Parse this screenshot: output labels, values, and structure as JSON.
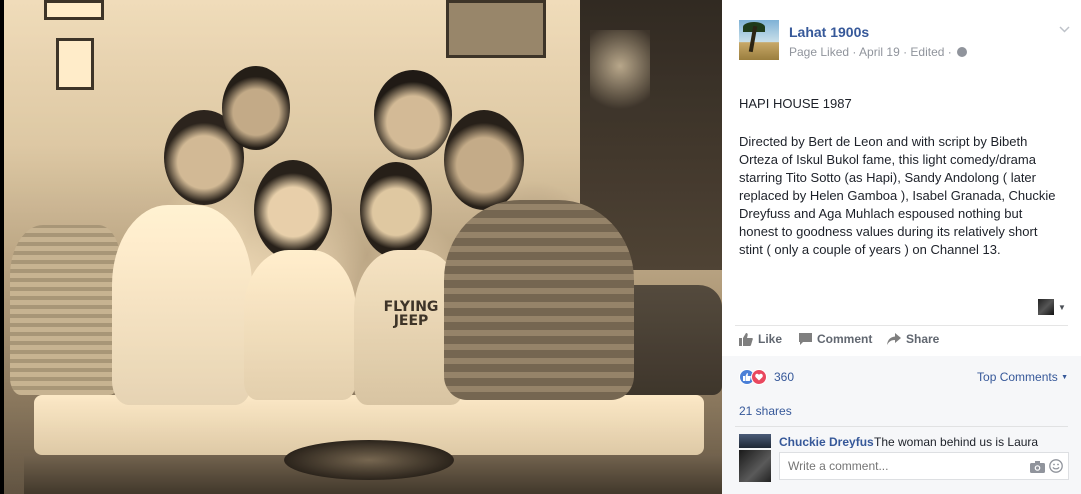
{
  "post": {
    "page_name": "Lahat 1900s",
    "meta": "Page Liked · April 19 · Edited ·",
    "title": "HAPI HOUSE 1987",
    "body": "Directed by Bert de Leon and with script by Bibeth Orteza of Iskul Bukol fame, this light comedy/drama starring Tito Sotto (as Hapi), Sandy Andolong ( later replaced by Helen Gamboa ), Isabel Granada, Chuckie Dreyfuss and Aga Muhlach espoused nothing but honest to goodness values during its relatively short stint ( only a couple of years ) on Channel 13."
  },
  "actions": {
    "like": "Like",
    "comment": "Comment",
    "share": "Share"
  },
  "reactions": {
    "count": "360",
    "top_comments": "Top Comments",
    "shares": "21 shares"
  },
  "comments": [
    {
      "author": "Chuckie Dreyfus",
      "text": "The woman behind us is Laura"
    }
  ],
  "composer": {
    "placeholder": "Write a comment..."
  },
  "photo": {
    "sign_text": "FLYING JEEP"
  },
  "colors": {
    "link": "#365899",
    "muted": "#90949c",
    "like_blue": "#4a7fd7",
    "love_red": "#e9485f"
  }
}
